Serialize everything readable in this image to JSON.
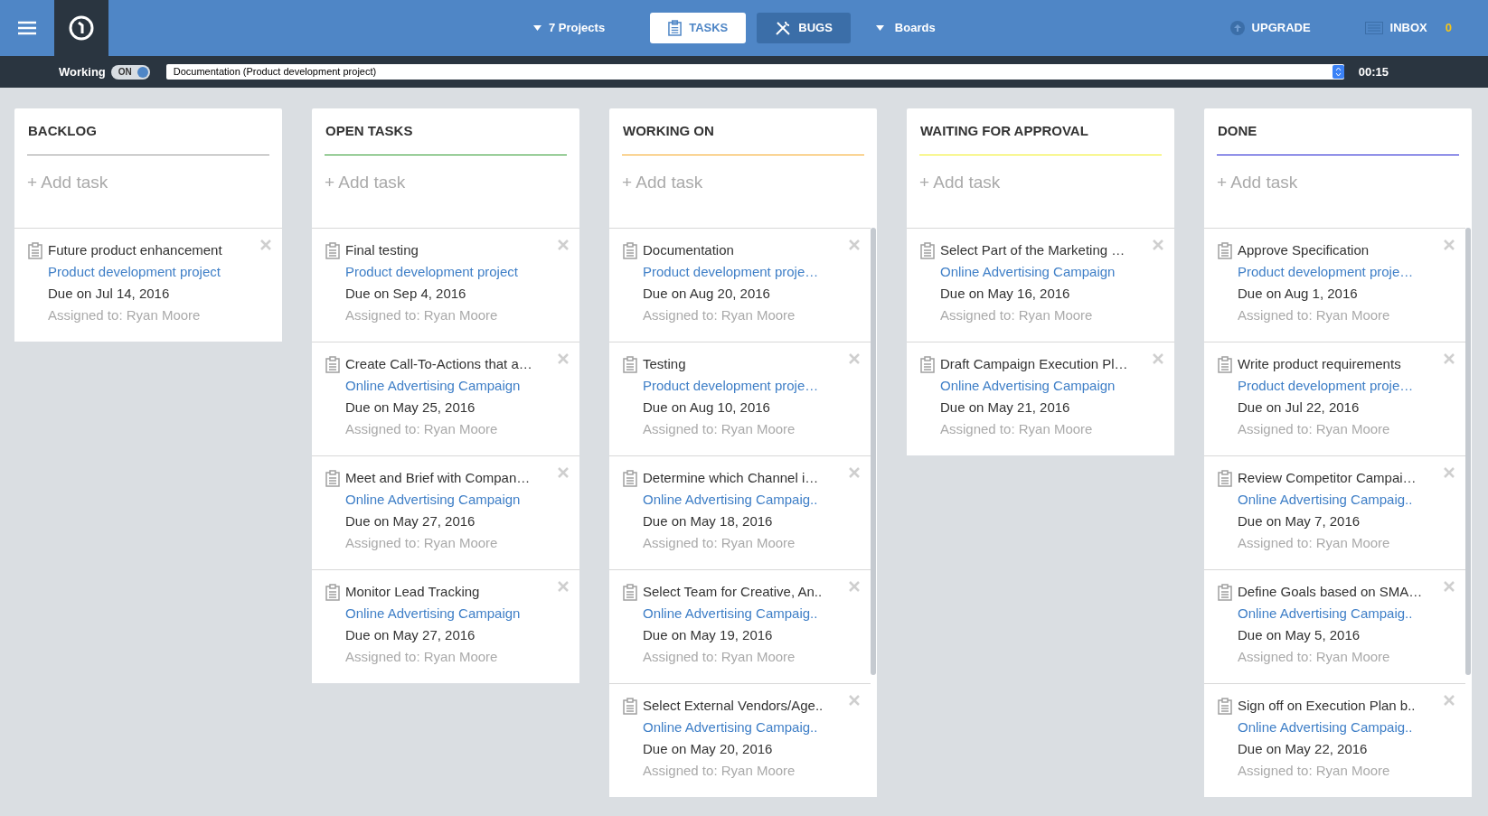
{
  "topbar": {
    "projects": "7 Projects",
    "tabs": [
      {
        "label": "TASKS",
        "kind": "tasks",
        "selected": true
      },
      {
        "label": "BUGS",
        "kind": "bugs",
        "selected": false
      }
    ],
    "boards": "Boards",
    "upgrade": "UPGRADE",
    "inbox": "INBOX",
    "inbox_count": "0"
  },
  "tracker": {
    "label": "Working",
    "toggle": {
      "label": "ON",
      "on": true
    },
    "task_select": "Documentation (Product development project)",
    "timer": "00:15"
  },
  "columns": [
    {
      "title": "BACKLOG",
      "color": "#9a9a9a",
      "add": "+ Add task",
      "scrollable": false,
      "cards": [
        {
          "title": "Future product enhancement",
          "project": "Product development project",
          "due": "Due on Jul 14, 2016",
          "assigned": "Assigned to: Ryan Moore"
        }
      ]
    },
    {
      "title": "OPEN TASKS",
      "color": "#2e9a2e",
      "add": "+ Add task",
      "scrollable": false,
      "cards": [
        {
          "title": "Final testing",
          "project": "Product development project",
          "due": "Due on Sep 4, 2016",
          "assigned": "Assigned to: Ryan Moore"
        },
        {
          "title": "Create Call-To-Actions that a…",
          "project": "Online Advertising Campaign",
          "due": "Due on May 25, 2016",
          "assigned": "Assigned to: Ryan Moore"
        },
        {
          "title": "Meet and Brief with Compan…",
          "project": "Online Advertising Campaign",
          "due": "Due on May 27, 2016",
          "assigned": "Assigned to: Ryan Moore"
        },
        {
          "title": "Monitor Lead Tracking",
          "project": "Online Advertising Campaign",
          "due": "Due on May 27, 2016",
          "assigned": "Assigned to: Ryan Moore"
        }
      ]
    },
    {
      "title": "WORKING ON",
      "color": "#f5a623",
      "add": "+ Add task",
      "scrollable": true,
      "cards": [
        {
          "title": "Documentation",
          "project": "Product development proje…",
          "due": "Due on Aug 20, 2016",
          "assigned": "Assigned to: Ryan Moore"
        },
        {
          "title": "Testing",
          "project": "Product development proje…",
          "due": "Due on Aug 10, 2016",
          "assigned": "Assigned to: Ryan Moore"
        },
        {
          "title": "Determine which Channel i…",
          "project": "Online Advertising Campaig..",
          "due": "Due on May 18, 2016",
          "assigned": "Assigned to: Ryan Moore"
        },
        {
          "title": "Select Team for Creative, An..",
          "project": "Online Advertising Campaig..",
          "due": "Due on May 19, 2016",
          "assigned": "Assigned to: Ryan Moore"
        },
        {
          "title": "Select External Vendors/Age..",
          "project": "Online Advertising Campaig..",
          "due": "Due on May 20, 2016",
          "assigned": "Assigned to: Ryan Moore"
        }
      ]
    },
    {
      "title": "WAITING FOR APPROVAL",
      "color": "#f0ee1e",
      "add": "+ Add task",
      "scrollable": false,
      "cards": [
        {
          "title": "Select Part of the Marketing …",
          "project": "Online Advertising Campaign",
          "due": "Due on May 16, 2016",
          "assigned": "Assigned to: Ryan Moore"
        },
        {
          "title": "Draft Campaign Execution Pl…",
          "project": "Online Advertising Campaign",
          "due": "Due on May 21, 2016",
          "assigned": "Assigned to: Ryan Moore"
        }
      ]
    },
    {
      "title": "DONE",
      "color": "#1a1ad0",
      "add": "+ Add task",
      "scrollable": true,
      "cards": [
        {
          "title": "Approve Specification",
          "project": "Product development proje…",
          "due": "Due on Aug 1, 2016",
          "assigned": "Assigned to: Ryan Moore"
        },
        {
          "title": "Write product requirements",
          "project": "Product development proje…",
          "due": "Due on Jul 22, 2016",
          "assigned": "Assigned to: Ryan Moore"
        },
        {
          "title": "Review Competitor Campai…",
          "project": "Online Advertising Campaig..",
          "due": "Due on May 7, 2016",
          "assigned": "Assigned to: Ryan Moore"
        },
        {
          "title": "Define Goals based on SMA…",
          "project": "Online Advertising Campaig..",
          "due": "Due on May 5, 2016",
          "assigned": "Assigned to: Ryan Moore"
        },
        {
          "title": "Sign off on Execution Plan b..",
          "project": "Online Advertising Campaig..",
          "due": "Due on May 22, 2016",
          "assigned": "Assigned to: Ryan Moore"
        }
      ]
    }
  ]
}
